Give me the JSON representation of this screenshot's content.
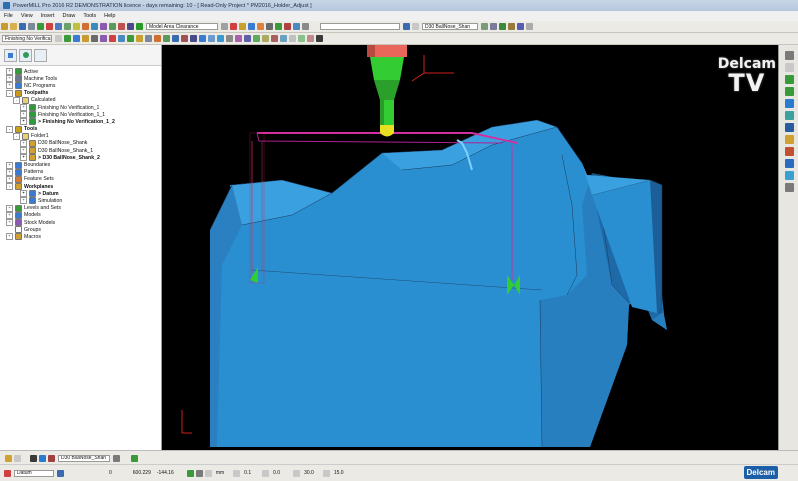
{
  "window": {
    "title": "PowerMILL Pro 2016 R2 DEMONSTRATION licence - days remaining: 10   -   [ Read-Only Project * PM2016_Holder_Adjust ]"
  },
  "menu": [
    "File",
    "View",
    "Insert",
    "Draw",
    "Tools",
    "Help"
  ],
  "toolbar1": {
    "mode_combo": "Model Area Clearance",
    "tool_combo": "D30 BallNose_Shan"
  },
  "toolbar2": {
    "toolpath_combo": "Finishing No Verificatio"
  },
  "tree": [
    {
      "label": "Active",
      "depth": 0,
      "exp": "+",
      "icon": "#3a9a3a",
      "bold": false
    },
    {
      "label": "Machine Tools",
      "depth": 0,
      "exp": "+",
      "icon": "#6a7a8a",
      "bold": false
    },
    {
      "label": "NC Programs",
      "depth": 0,
      "exp": "+",
      "icon": "#3a7ad0",
      "bold": false
    },
    {
      "label": "Toolpaths",
      "depth": 0,
      "exp": "-",
      "icon": "#c89a20",
      "bold": true
    },
    {
      "label": "Calculated",
      "depth": 1,
      "exp": "-",
      "icon": "#e8d070",
      "bold": false
    },
    {
      "label": "Finishing No Verification_1",
      "depth": 2,
      "exp": "+",
      "icon": "#2f9a3a",
      "bold": false
    },
    {
      "label": "Finishing No Verification_1_1",
      "depth": 2,
      "exp": "+",
      "icon": "#2f9a3a",
      "bold": false
    },
    {
      "label": "> Finishing No Verification_1_2",
      "depth": 2,
      "exp": "+",
      "icon": "#2f9a3a",
      "bold": true
    },
    {
      "label": "Tools",
      "depth": 0,
      "exp": "-",
      "icon": "#c8a020",
      "bold": true
    },
    {
      "label": "Folder1",
      "depth": 1,
      "exp": "-",
      "icon": "#e8d070",
      "bold": false
    },
    {
      "label": "D30 BallNose_Shank",
      "depth": 2,
      "exp": "+",
      "icon": "#d0a030",
      "bold": false
    },
    {
      "label": "D30 BallNose_Shank_1",
      "depth": 2,
      "exp": "+",
      "icon": "#d0a030",
      "bold": false
    },
    {
      "label": "> D30 BallNose_Shank_2",
      "depth": 2,
      "exp": "+",
      "icon": "#d0a030",
      "bold": true
    },
    {
      "label": "Boundaries",
      "depth": 0,
      "exp": "+",
      "icon": "#3a7ad0",
      "bold": false
    },
    {
      "label": "Patterns",
      "depth": 0,
      "exp": "+",
      "icon": "#3a7ad0",
      "bold": false
    },
    {
      "label": "Feature Sets",
      "depth": 0,
      "exp": "+",
      "icon": "#d07a3a",
      "bold": false
    },
    {
      "label": "Workplanes",
      "depth": 0,
      "exp": "-",
      "icon": "#d0a030",
      "bold": true
    },
    {
      "label": "> Datum",
      "depth": 2,
      "exp": "+",
      "icon": "#3a7ad0",
      "bold": true
    },
    {
      "label": "Simulation",
      "depth": 2,
      "exp": "+",
      "icon": "#3a7ad0",
      "bold": false
    },
    {
      "label": "Levels and Sets",
      "depth": 0,
      "exp": "+",
      "icon": "#3a9a3a",
      "bold": false
    },
    {
      "label": "Models",
      "depth": 0,
      "exp": "+",
      "icon": "#3a7ad0",
      "bold": false
    },
    {
      "label": "Stock Models",
      "depth": 0,
      "exp": "+",
      "icon": "#8a5ab0",
      "bold": false
    },
    {
      "label": "Groups",
      "depth": 0,
      "exp": "",
      "icon": "#ffffff",
      "bold": false
    },
    {
      "label": "Macros",
      "depth": 0,
      "exp": "+",
      "icon": "#d0a030",
      "bold": false
    }
  ],
  "watermark": {
    "line1": "Delcam",
    "line2": "TV"
  },
  "status_row1": {
    "tool_combo": "D30 BallNose_Shan"
  },
  "status_row2": {
    "workplane_combo": "Datum",
    "x": "0",
    "y": "600.229",
    "z": "-144.16",
    "units": "mm",
    "tolerance": "0.1",
    "thickness": "0.0",
    "angle1": "30.0",
    "angle2": "15.0"
  },
  "brand": "Delcam",
  "colors": {
    "model": "#2a8fd0",
    "toolpath": "#cc2a8a",
    "tool_shank": "#e8665a",
    "tool_holder": "#33cc33",
    "tool_tip": "#e6e020"
  }
}
